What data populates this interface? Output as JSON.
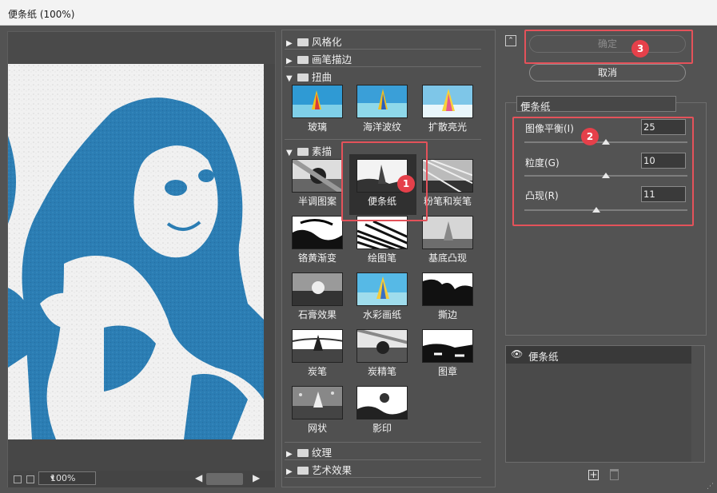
{
  "window": {
    "title": "便条纸 (100%)"
  },
  "preview": {
    "zoom": "100%",
    "icons": [
      "collapse-preview-icon",
      "fit-icon"
    ]
  },
  "gallery": {
    "categories": [
      {
        "label": "风格化",
        "expanded": false
      },
      {
        "label": "画笔描边",
        "expanded": false
      },
      {
        "label": "扭曲",
        "expanded": true,
        "filters": [
          "玻璃",
          "海洋波纹",
          "扩散亮光"
        ]
      },
      {
        "label": "素描",
        "expanded": true,
        "filters": [
          "半调图案",
          "便条纸",
          "粉笔和炭笔",
          "铬黄渐变",
          "绘图笔",
          "基底凸现",
          "石膏效果",
          "水彩画纸",
          "撕边",
          "炭笔",
          "炭精笔",
          "图章",
          "网状",
          "影印"
        ]
      },
      {
        "label": "纹理",
        "expanded": false
      },
      {
        "label": "艺术效果",
        "expanded": false
      }
    ],
    "selected_filter": "便条纸"
  },
  "buttons": {
    "ok": "确定",
    "cancel": "取消"
  },
  "settings": {
    "filter": "便条纸",
    "params": [
      {
        "label": "图像平衡(I)",
        "value": "25",
        "level": 0.5
      },
      {
        "label": "粒度(G)",
        "value": "10",
        "level": 0.5
      },
      {
        "label": "凸现(R)",
        "value": "11",
        "level": 0.44
      }
    ]
  },
  "layers": {
    "items": [
      {
        "name": "便条纸",
        "visible": true
      }
    ]
  },
  "annotations": [
    "1",
    "2",
    "3"
  ],
  "colors": {
    "accent_annotation": "#e4525a",
    "poster_blue": "#2a7fb5"
  }
}
